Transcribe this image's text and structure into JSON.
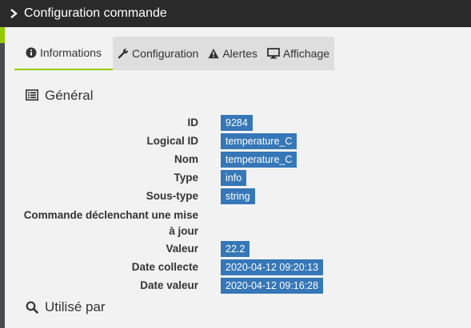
{
  "window": {
    "title": "Configuration commande"
  },
  "tabs": [
    {
      "label": "Informations",
      "icon": "info-circle-icon",
      "active": true
    },
    {
      "label": "Configuration",
      "icon": "wrench-icon",
      "active": false
    },
    {
      "label": "Alertes",
      "icon": "warning-icon",
      "active": false
    },
    {
      "label": "Affichage",
      "icon": "monitor-icon",
      "active": false
    }
  ],
  "general": {
    "title": "Général",
    "icon": "list-icon",
    "fields": [
      {
        "label": "ID",
        "value": "9284"
      },
      {
        "label": "Logical ID",
        "value": "temperature_C"
      },
      {
        "label": "Nom",
        "value": "temperature_C"
      },
      {
        "label": "Type",
        "value": "info"
      },
      {
        "label": "Sous-type",
        "value": "string"
      },
      {
        "label": "Commande déclenchant une mise à jour",
        "value": ""
      },
      {
        "label": "Valeur",
        "value": "22.2"
      },
      {
        "label": "Date collecte",
        "value": "2020-04-12 09:20:13"
      },
      {
        "label": "Date valeur",
        "value": "2020-04-12 09:16:28"
      }
    ]
  },
  "used_by": {
    "title": "Utilisé par",
    "icon": "search-icon"
  },
  "colors": {
    "accent": "#94ca02",
    "badge": "#3677b8",
    "titlebar": "#2a2a2a"
  }
}
